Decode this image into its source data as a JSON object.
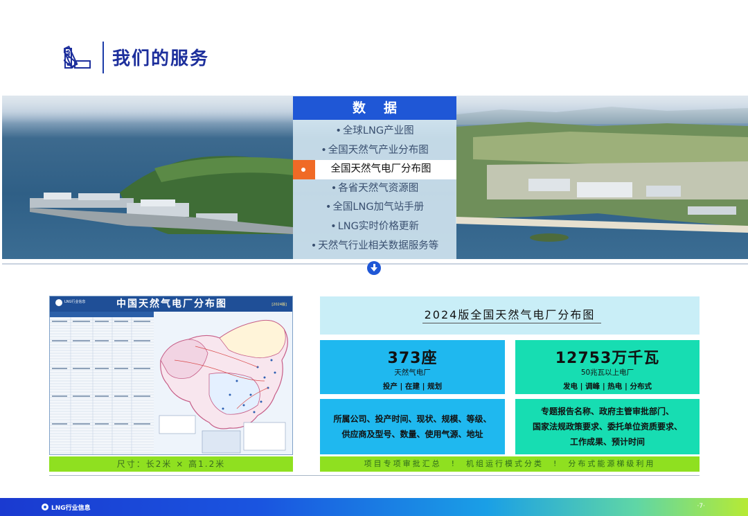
{
  "header": {
    "title": "我们的服务"
  },
  "data_panel": {
    "title": "数据",
    "items": [
      {
        "label": "全球LNG产业图"
      },
      {
        "label": "全国天然气产业分布图"
      },
      {
        "label": "全国天然气电厂分布图"
      },
      {
        "label": "各省天然气资源图"
      },
      {
        "label": "全国LNG加气站手册"
      },
      {
        "label": "LNG实时价格更新"
      },
      {
        "label": "天然气行业相关数据服务等"
      }
    ],
    "active_index": 2
  },
  "map_card": {
    "title": "中国天然气电厂分布图",
    "logo_text": "LNG行业信息",
    "year_badge": "[2024版]",
    "size_caption": "尺寸：长2米 × 高1.2米"
  },
  "atlas": {
    "title": "2024版全国天然气电厂分布图"
  },
  "stats": {
    "plants": {
      "value": "373座",
      "sub": "天然气电厂",
      "tags": "投产 | 在建 | 规划"
    },
    "capacity": {
      "value": "12753万千瓦",
      "sub": "50兆瓦以上电厂",
      "tags": "发电 | 调峰 | 热电 | 分布式"
    }
  },
  "descriptions": {
    "blue": [
      "所属公司、投产时间、现状、规模、等级、",
      "供应商及型号、数量、使用气源、地址"
    ],
    "green": [
      "专题报告名称、政府主管审批部门、",
      "国家法规政策要求、委托单位资质要求、",
      "工作成果、预计时间"
    ]
  },
  "bottom_bar": "项目专项审批汇总　!　机组运行模式分类　!　分布式能源梯级利用",
  "footer": {
    "brand": "LNG行业信息",
    "page": "·7·"
  },
  "colors": {
    "primary": "#1f57d6",
    "accent_orange": "#f06a26",
    "blue_box": "#1fb8ef",
    "green_box": "#17ddb2",
    "lime_bar": "#8fe020",
    "title_navy": "#1d2f9c"
  }
}
